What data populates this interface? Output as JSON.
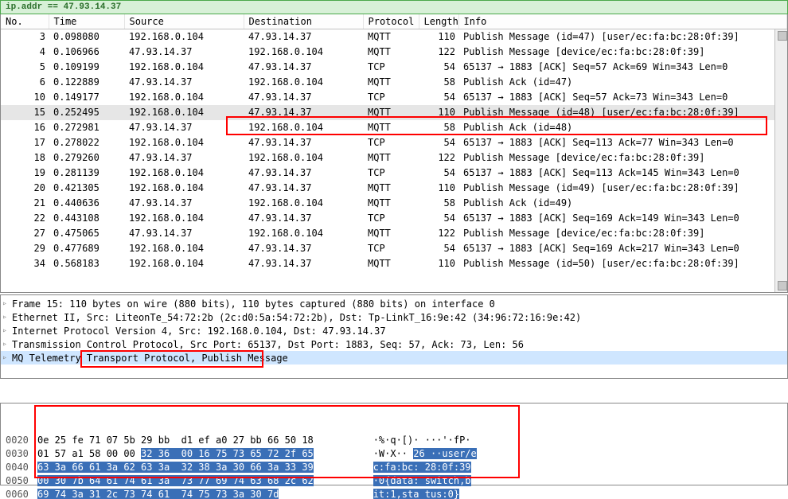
{
  "titlebar": {
    "text": "ip.addr == 47.93.14.37"
  },
  "columns": [
    "No.",
    "Time",
    "Source",
    "Destination",
    "Protocol",
    "Length",
    "Info"
  ],
  "packets": [
    {
      "no": "3",
      "time": "0.098080",
      "src": "192.168.0.104",
      "dst": "47.93.14.37",
      "proto": "MQTT",
      "len": "110",
      "info": "Publish Message (id=47) [user/ec:fa:bc:28:0f:39]"
    },
    {
      "no": "4",
      "time": "0.106966",
      "src": "47.93.14.37",
      "dst": "192.168.0.104",
      "proto": "MQTT",
      "len": "122",
      "info": "Publish Message [device/ec:fa:bc:28:0f:39]"
    },
    {
      "no": "5",
      "time": "0.109199",
      "src": "192.168.0.104",
      "dst": "47.93.14.37",
      "proto": "TCP",
      "len": "54",
      "info": "65137 → 1883 [ACK] Seq=57 Ack=69 Win=343 Len=0"
    },
    {
      "no": "6",
      "time": "0.122889",
      "src": "47.93.14.37",
      "dst": "192.168.0.104",
      "proto": "MQTT",
      "len": "58",
      "info": "Publish Ack (id=47)"
    },
    {
      "no": "10",
      "time": "0.149177",
      "src": "192.168.0.104",
      "dst": "47.93.14.37",
      "proto": "TCP",
      "len": "54",
      "info": "65137 → 1883 [ACK] Seq=57 Ack=73 Win=343 Len=0"
    },
    {
      "no": "15",
      "time": "0.252495",
      "src": "192.168.0.104",
      "dst": "47.93.14.37",
      "proto": "MQTT",
      "len": "110",
      "info": "Publish Message (id=48) [user/ec:fa:bc:28:0f:39]",
      "selected": true
    },
    {
      "no": "16",
      "time": "0.272981",
      "src": "47.93.14.37",
      "dst": "192.168.0.104",
      "proto": "MQTT",
      "len": "58",
      "info": "Publish Ack (id=48)"
    },
    {
      "no": "17",
      "time": "0.278022",
      "src": "192.168.0.104",
      "dst": "47.93.14.37",
      "proto": "TCP",
      "len": "54",
      "info": "65137 → 1883 [ACK] Seq=113 Ack=77 Win=343 Len=0"
    },
    {
      "no": "18",
      "time": "0.279260",
      "src": "47.93.14.37",
      "dst": "192.168.0.104",
      "proto": "MQTT",
      "len": "122",
      "info": "Publish Message [device/ec:fa:bc:28:0f:39]"
    },
    {
      "no": "19",
      "time": "0.281139",
      "src": "192.168.0.104",
      "dst": "47.93.14.37",
      "proto": "TCP",
      "len": "54",
      "info": "65137 → 1883 [ACK] Seq=113 Ack=145 Win=343 Len=0"
    },
    {
      "no": "20",
      "time": "0.421305",
      "src": "192.168.0.104",
      "dst": "47.93.14.37",
      "proto": "MQTT",
      "len": "110",
      "info": "Publish Message (id=49) [user/ec:fa:bc:28:0f:39]"
    },
    {
      "no": "21",
      "time": "0.440636",
      "src": "47.93.14.37",
      "dst": "192.168.0.104",
      "proto": "MQTT",
      "len": "58",
      "info": "Publish Ack (id=49)"
    },
    {
      "no": "22",
      "time": "0.443108",
      "src": "192.168.0.104",
      "dst": "47.93.14.37",
      "proto": "TCP",
      "len": "54",
      "info": "65137 → 1883 [ACK] Seq=169 Ack=149 Win=343 Len=0"
    },
    {
      "no": "27",
      "time": "0.475065",
      "src": "47.93.14.37",
      "dst": "192.168.0.104",
      "proto": "MQTT",
      "len": "122",
      "info": "Publish Message [device/ec:fa:bc:28:0f:39]"
    },
    {
      "no": "29",
      "time": "0.477689",
      "src": "192.168.0.104",
      "dst": "47.93.14.37",
      "proto": "TCP",
      "len": "54",
      "info": "65137 → 1883 [ACK] Seq=169 Ack=217 Win=343 Len=0"
    },
    {
      "no": "34",
      "time": "0.568183",
      "src": "192.168.0.104",
      "dst": "47.93.14.37",
      "proto": "MQTT",
      "len": "110",
      "info": "Publish Message (id=50) [user/ec:fa:bc:28:0f:39]"
    }
  ],
  "details": [
    "Frame 15: 110 bytes on wire (880 bits), 110 bytes captured (880 bits) on interface 0",
    "Ethernet II, Src: LiteonTe_54:72:2b (2c:d0:5a:54:72:2b), Dst: Tp-LinkT_16:9e:42 (34:96:72:16:9e:42)",
    "Internet Protocol Version 4, Src: 192.168.0.104, Dst: 47.93.14.37",
    "Transmission Control Protocol, Src Port: 65137, Dst Port: 1883, Seq: 57, Ack: 73, Len: 56",
    "MQ Telemetry Transport Protocol, Publish Message"
  ],
  "details_selected_index": 4,
  "hex": [
    {
      "addr": "0020",
      "b1": "0e 25 fe 71 07 5b 29 bb ",
      "b2": " d1 ef a0 27 bb 66 50 18",
      "a1": "·%·q·[)· ",
      "a2": "···'·fP·",
      "h1": false,
      "h2": false,
      "ha1": false,
      "ha2": false
    },
    {
      "addr": "0030",
      "b1": "01 57 a1 58 00 00 ",
      "b2": "32 36  00 16 75 73 65 72 2f 65",
      "a1": "·W·X·· ",
      "a2": "26 ··user/e",
      "h1": false,
      "h2": true,
      "ha1": false,
      "ha2": true
    },
    {
      "addr": "0040",
      "b1": "63 3a 66 61 3a 62 63 3a ",
      "b2": " 32 38 3a 30 66 3a 33 39",
      "a1": "c:fa:bc: ",
      "a2": "28:0f:39",
      "h1": true,
      "h2": true,
      "ha1": true,
      "ha2": true
    },
    {
      "addr": "0050",
      "b1": "00 30 7b 64 61 74 61 3a ",
      "b2": " 73 77 69 74 63 68 2c 62",
      "a1": "·0{data: ",
      "a2": "switch,b",
      "h1": true,
      "h2": true,
      "ha1": true,
      "ha2": true
    },
    {
      "addr": "0060",
      "b1": "69 74 3a 31 2c 73 74 61 ",
      "b2": " 74 75 73 3a 30 7d",
      "a1": "it:1,sta ",
      "a2": "tus:0}",
      "h1": true,
      "h2": true,
      "ha1": true,
      "ha2": true
    }
  ]
}
